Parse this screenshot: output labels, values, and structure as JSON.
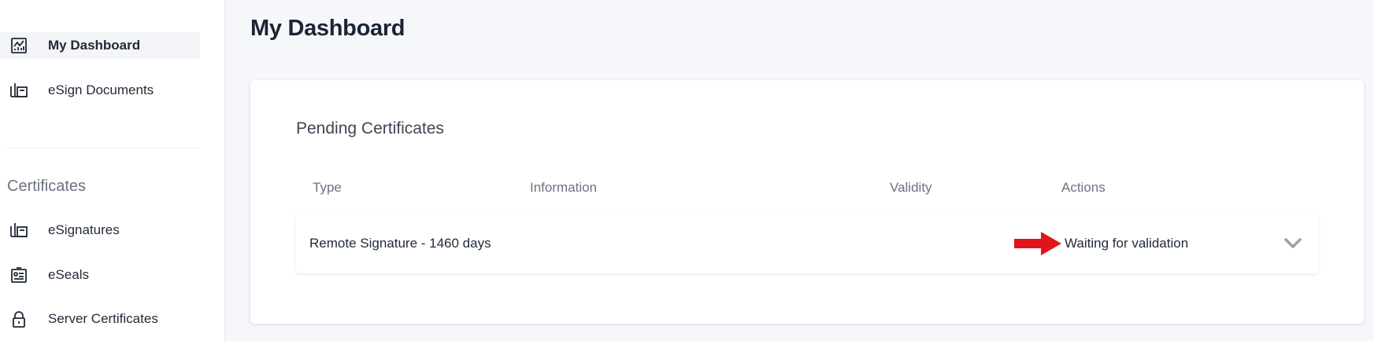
{
  "sidebar": {
    "items": [
      {
        "label": "My Dashboard",
        "icon": "chart-icon",
        "active": true
      },
      {
        "label": "eSign Documents",
        "icon": "document-sign-icon"
      }
    ],
    "section_title": "Certificates",
    "cert_items": [
      {
        "label": "eSignatures",
        "icon": "document-sign-icon"
      },
      {
        "label": "eSeals",
        "icon": "seal-icon"
      },
      {
        "label": "Server Certificates",
        "icon": "lock-icon"
      }
    ]
  },
  "main": {
    "title": "My Dashboard",
    "card": {
      "title": "Pending Certificates",
      "columns": [
        "Type",
        "Information",
        "Validity",
        "Actions"
      ],
      "rows": [
        {
          "type": "Remote Signature - 1460 days",
          "information": "",
          "validity": "",
          "action": "Waiting for validation"
        }
      ]
    }
  },
  "colors": {
    "annotation_arrow": "#e0151b",
    "text": "#1f2a37",
    "muted": "#6b7280"
  }
}
